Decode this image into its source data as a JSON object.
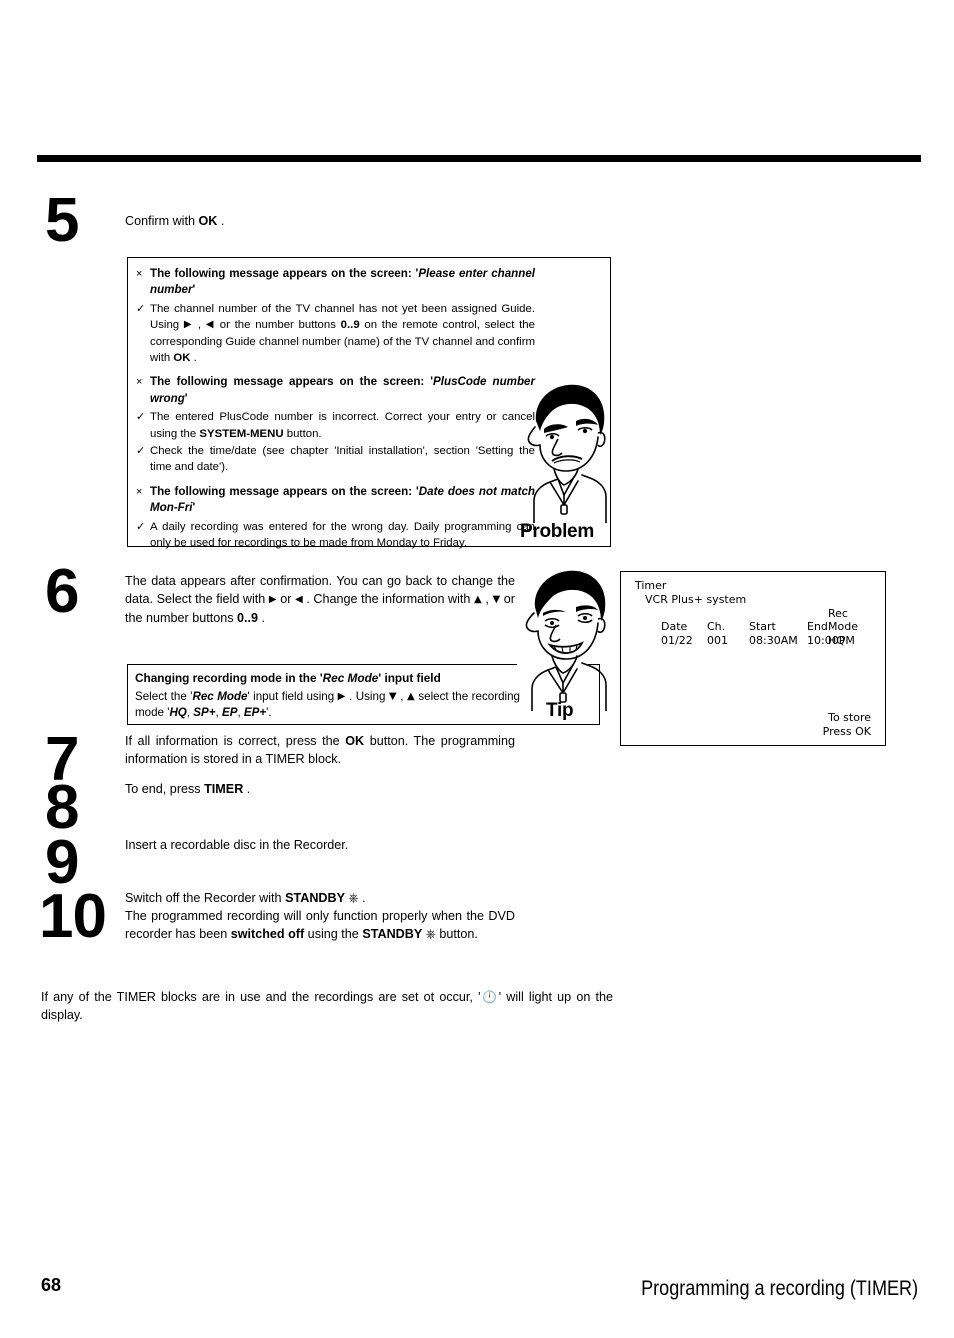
{
  "page": {
    "number": "68",
    "footer_title": "Programming a recording (TIMER)"
  },
  "steps": [
    {
      "number": "5",
      "text_html": "Confirm with  <b>OK</b> ."
    },
    {
      "number": "6",
      "text_html": "The data appears after confirmation. You can go back to change the data. Select the field with <span class=\"sym arrow\">&#9654;</span> or <span class=\"sym arrow\">&#9664;</span> . Change the information with <span class=\"sym arrow\">&#9650;</span> , <span class=\"sym arrow\">&#9660;</span> or the number buttons  <b>0..9</b> ."
    },
    {
      "number": "7",
      "text_html": "If all information is correct, press the  <b>OK</b> button. The programming information is stored in a TIMER block."
    },
    {
      "number": "8",
      "text_html": "To end, press  <b>TIMER</b> ."
    },
    {
      "number": "9",
      "text_html": "Insert a recordable disc in the Recorder."
    },
    {
      "number": "10",
      "text_html": "Switch off the Recorder with  <b>STANDBY</b> <span class=\"sym\">&#9096;</span> .<br>The programmed recording will only function properly when the DVD recorder has been <b>switched off</b> using the  <b>STANDBY</b> <span class=\"sym\">&#9096;</span> button."
    }
  ],
  "problem_box": {
    "caption": "Problem",
    "items": [
      {
        "mark": "×",
        "kind": "head",
        "html": "The following message appears on the screen: '<i>Please enter channel number</i>'"
      },
      {
        "mark": "✓",
        "kind": "body",
        "html": "The channel number of the TV channel has not yet been assigned Guide. Using <span class=\"sym arrow\">&#9654;</span> , <span class=\"sym arrow\">&#9664;</span> or the number buttons  <b>0..9</b> on the remote control, select the corresponding Guide channel number (name) of the TV channel and confirm with  <b>OK</b> ."
      },
      {
        "mark": "×",
        "kind": "head",
        "html": "The following message appears on the screen: '<i>PlusCode number wrong</i>'"
      },
      {
        "mark": "✓",
        "kind": "body",
        "html": "The entered PlusCode number is incorrect. Correct your entry or cancel using the  <b>SYSTEM-MENU</b> button."
      },
      {
        "mark": "✓",
        "kind": "body",
        "html": "Check the time/date (see chapter 'Initial installation', section 'Setting the time and date')."
      },
      {
        "mark": "×",
        "kind": "head",
        "html": "The following message appears on the screen: '<i>Date does not match Mon-Fri</i>'"
      },
      {
        "mark": "✓",
        "kind": "body",
        "html": "A daily recording was entered for the wrong day. Daily programming can only be used for recordings to be made from Monday to Friday."
      }
    ]
  },
  "tip_box": {
    "caption": "Tip",
    "heading_html": "Changing recording mode in the '<i>Rec Mode</i>' input field",
    "body_html": "Select the '<i>Rec Mode</i>' input field using <span class=\"sym arrow\">&#9654;</span> . Using <span class=\"sym arrow\">&#9660;</span> , <span class=\"sym arrow\">&#9650;</span> select the recording mode '<i>HQ</i>, <i>SP+</i>, <i>EP</i>, <i>EP+</i>'."
  },
  "timer_screen": {
    "title": "Timer",
    "subtitle": "VCR Plus+ system",
    "rec_word": "Rec",
    "columns": [
      "Date",
      "Ch.",
      "Start",
      "End",
      "Mode"
    ],
    "row": [
      "01/22",
      "001",
      "08:30AM",
      "10:00PM",
      "HQ"
    ],
    "store_line1": "To store",
    "store_line2": "Press OK"
  },
  "note": {
    "html": "If any of the TIMER blocks are in use and the recordings are set ot occur, '<span class=\"sym clk\">&#128347;</span>' will light up on the display."
  }
}
